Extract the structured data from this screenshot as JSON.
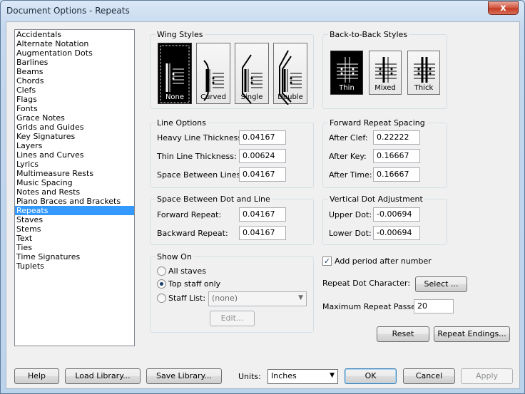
{
  "window": {
    "title": "Document Options - Repeats",
    "close_glyph": "x"
  },
  "categories": {
    "items": [
      "Accidentals",
      "Alternate Notation",
      "Augmentation Dots",
      "Barlines",
      "Beams",
      "Chords",
      "Clefs",
      "Flags",
      "Fonts",
      "Grace Notes",
      "Grids and Guides",
      "Key Signatures",
      "Layers",
      "Lines and Curves",
      "Lyrics",
      "Multimeasure Rests",
      "Music Spacing",
      "Notes and Rests",
      "Piano Braces and Brackets",
      "Repeats",
      "Staves",
      "Stems",
      "Text",
      "Ties",
      "Time Signatures",
      "Tuplets"
    ],
    "selected": "Repeats"
  },
  "wing_styles": {
    "label": "Wing Styles",
    "options": [
      "None",
      "Curved",
      "Single",
      "Double"
    ],
    "selected": "None"
  },
  "back_to_back": {
    "label": "Back-to-Back Styles",
    "options": [
      "Thin",
      "Mixed",
      "Thick"
    ],
    "selected": "Thin"
  },
  "line_options": {
    "label": "Line Options",
    "heavy_label": "Heavy Line Thickness:",
    "heavy_value": "0.04167",
    "thin_label": "Thin Line Thickness:",
    "thin_value": "0.00624",
    "space_label": "Space Between Lines:",
    "space_value": "0.04167"
  },
  "forward_spacing": {
    "label": "Forward Repeat Spacing",
    "after_clef_label": "After Clef:",
    "after_clef_value": "0.22222",
    "after_key_label": "After Key:",
    "after_key_value": "0.16667",
    "after_time_label": "After Time:",
    "after_time_value": "0.16667"
  },
  "dot_line": {
    "label": "Space Between Dot and Line",
    "forward_label": "Forward Repeat:",
    "forward_value": "0.04167",
    "backward_label": "Backward Repeat:",
    "backward_value": "0.04167"
  },
  "vertical_dot": {
    "label": "Vertical Dot Adjustment",
    "upper_label": "Upper Dot:",
    "upper_value": "-0.00694",
    "lower_label": "Lower Dot:",
    "lower_value": "-0.00694"
  },
  "show_on": {
    "label": "Show On",
    "all_staves": "All staves",
    "top_staff": "Top staff only",
    "staff_list": "Staff List:",
    "staff_list_value": "(none)",
    "edit_label": "Edit..."
  },
  "period": {
    "label": "Add period after number",
    "checked": true
  },
  "repeat_dot": {
    "label": "Repeat Dot Character:",
    "button": "Select ..."
  },
  "max_passes": {
    "label": "Maximum Repeat Passes:",
    "value": "20"
  },
  "actions": {
    "reset": "Reset",
    "repeat_endings": "Repeat Endings..."
  },
  "footer": {
    "help": "Help",
    "load_library": "Load Library...",
    "save_library": "Save Library...",
    "units_label": "Units:",
    "units_value": "Inches",
    "ok": "OK",
    "cancel": "Cancel",
    "apply": "Apply"
  }
}
